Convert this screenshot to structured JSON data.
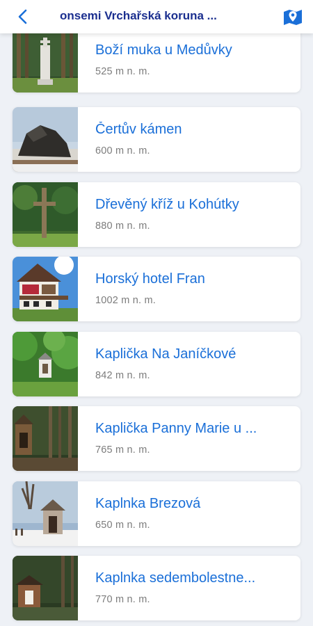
{
  "header": {
    "title": "onsemi Vrchařská koruna ...",
    "back_icon": "chevron-left-icon",
    "map_icon": "map-pin-icon",
    "accent": "#1b2f8f",
    "icon_color": "#1a6fd8"
  },
  "items": [
    {
      "name": "Boží muka u Medůvky",
      "elevation": "525 m n. m.",
      "photo": "wooden-cross-monument"
    },
    {
      "name": "Čertův kámen",
      "elevation": "600 m n. m.",
      "photo": "rock-formation"
    },
    {
      "name": "Dřevěný kříž u Kohútky",
      "elevation": "880 m n. m.",
      "photo": "wooden-cross"
    },
    {
      "name": "Horský hotel Fran",
      "elevation": "1002 m n. m.",
      "photo": "mountain-hotel"
    },
    {
      "name": "Kaplička Na Janíčkové",
      "elevation": "842 m n. m.",
      "photo": "small-chapel"
    },
    {
      "name": "Kaplička Panny Marie u ...",
      "elevation": "765 m n. m.",
      "photo": "forest-chapel"
    },
    {
      "name": "Kaplnka Brezová",
      "elevation": "650 m n. m.",
      "photo": "winter-chapel"
    },
    {
      "name": "Kaplnka sedembolestne...",
      "elevation": "770 m n. m.",
      "photo": "wooden-chapel"
    }
  ]
}
